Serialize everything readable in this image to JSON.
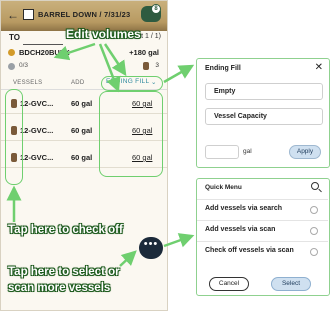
{
  "header": {
    "back_icon": "arrow-left-icon",
    "title": "BARREL DOWN / 7/31/23",
    "sync_badge": "8"
  },
  "to_row": {
    "label": "TO",
    "lot": "Lot 1 / 1)"
  },
  "bulk": {
    "name": "BDCH20BULK",
    "amount": "+180 gal"
  },
  "counts": {
    "left": "0/3",
    "right": "3"
  },
  "columns": {
    "vessels": "VESSELS",
    "add": "ADD",
    "ending_fill": "ENDING FILL",
    "chevron": "⌄"
  },
  "vessels": [
    {
      "name": "12-GVC...",
      "add": "60 gal",
      "fill": "60 gal"
    },
    {
      "name": "12-GVC...",
      "add": "60 gal",
      "fill": "60 gal"
    },
    {
      "name": "12-GVC...",
      "add": "60 gal",
      "fill": "60 gal"
    }
  ],
  "fab": {
    "label": "•••"
  },
  "annotations": {
    "edit": "Edit volumes",
    "check": "Tap here to check off",
    "scan_line1": "Tap here to select or",
    "scan_line2": "scan more vessels"
  },
  "ending_fill_panel": {
    "title": "Ending Fill",
    "close": "✕",
    "option1": "Empty",
    "option2": "Vessel Capacity",
    "gal_label": "gal",
    "apply": "Apply"
  },
  "quick_menu": {
    "title": "Quick Menu",
    "items": [
      "Add vessels via search",
      "Add vessels via scan",
      "Check off vessels via scan"
    ],
    "cancel": "Cancel",
    "select": "Select"
  },
  "colors": {
    "highlight": "#6fcf6f",
    "accent": "#2f8a9e",
    "fab": "#1b2a3a"
  }
}
